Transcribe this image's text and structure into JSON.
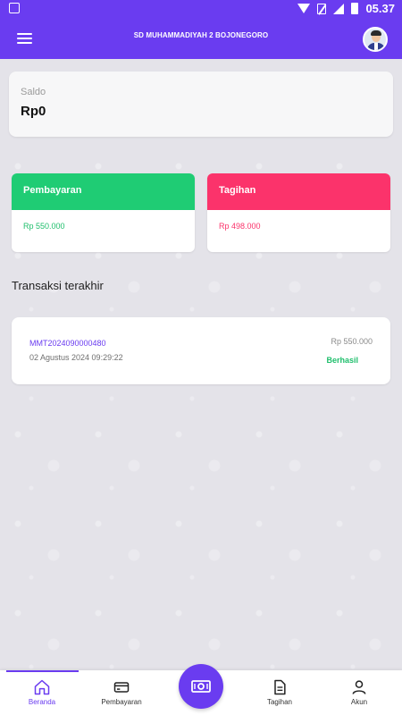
{
  "status_bar": {
    "time": "05.37"
  },
  "app_bar": {
    "title": "SD MUHAMMADIYAH 2 BOJONEGORO"
  },
  "saldo": {
    "label": "Saldo",
    "value": "Rp0"
  },
  "cards": {
    "pembayaran": {
      "title": "Pembayaran",
      "amount": "Rp 550.000",
      "color": "#1fcc74"
    },
    "tagihan": {
      "title": "Tagihan",
      "amount": "Rp 498.000",
      "color": "#fb336b"
    }
  },
  "recent": {
    "title": "Transaksi terakhir",
    "transactions": [
      {
        "id": "MMT2024090000480",
        "date": "02 Agustus 2024 09:29:22",
        "amount": "Rp 550.000",
        "status": "Berhasil"
      }
    ]
  },
  "bottom_nav": {
    "items": [
      {
        "label": "Beranda",
        "icon": "home-icon",
        "active": true
      },
      {
        "label": "Pembayaran",
        "icon": "card-icon",
        "active": false
      },
      {
        "label": "",
        "icon": "cash-icon",
        "active": false
      },
      {
        "label": "Tagihan",
        "icon": "document-icon",
        "active": false
      },
      {
        "label": "Akun",
        "icon": "user-icon",
        "active": false
      }
    ]
  },
  "colors": {
    "primary": "#6a3cf0",
    "success": "#1fcc74",
    "danger": "#fb336b"
  }
}
